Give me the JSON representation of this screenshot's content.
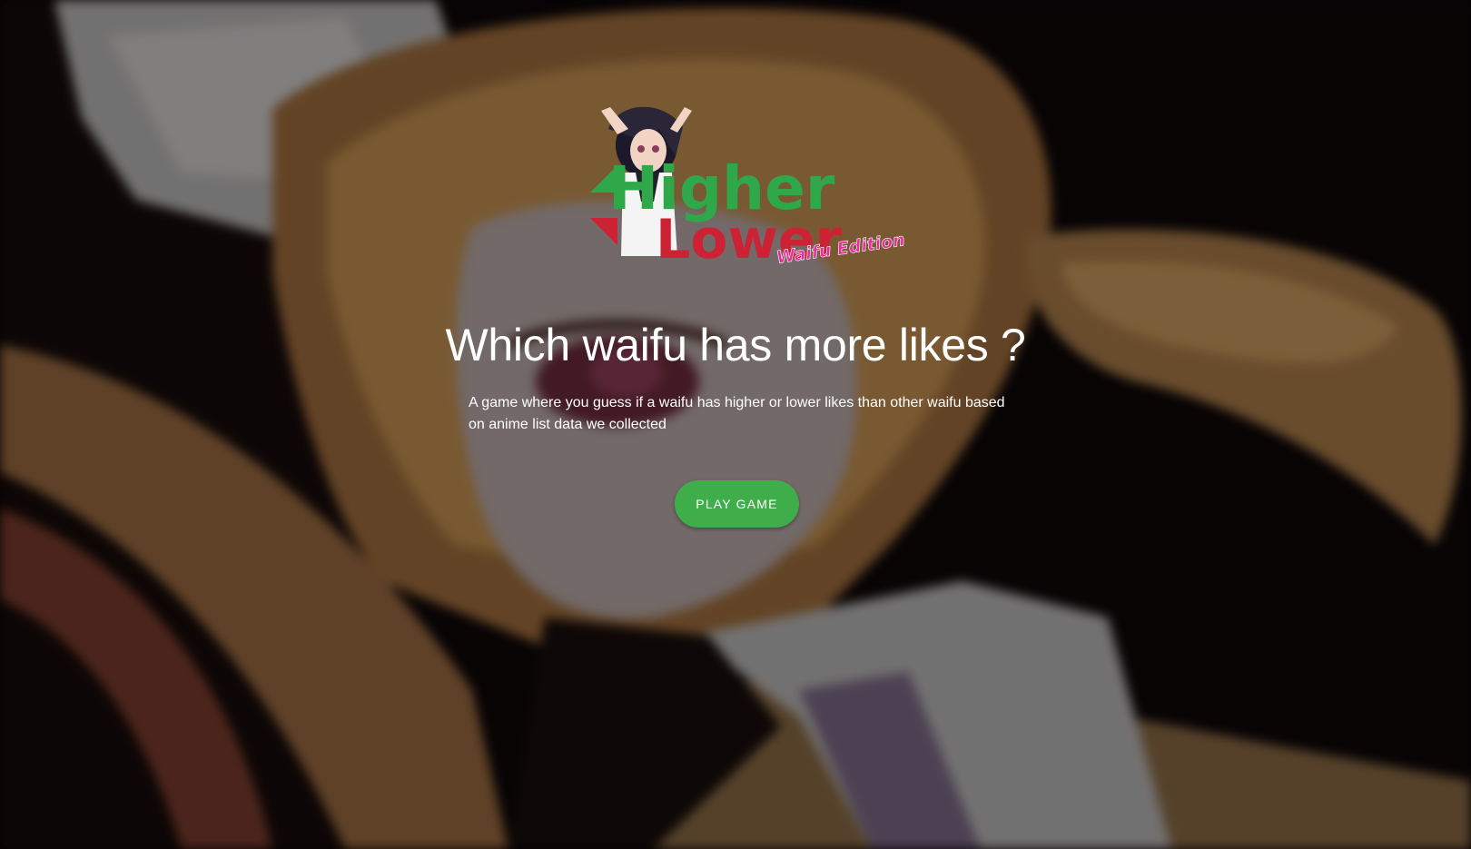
{
  "logo": {
    "line1": "Higher",
    "line2": "Lower",
    "tagline": "Waifu Edition",
    "colors": {
      "higher": "#2fa84a",
      "lower": "#cc2233",
      "tagline": "#e0309a"
    }
  },
  "hero": {
    "title": "Which waifu has more likes ?",
    "description": "A game where you guess if a waifu has higher or lower likes than other waifu based on anime list data we collected"
  },
  "actions": {
    "play_label": "PLAY GAME"
  },
  "theme": {
    "button_color": "#3fae4a",
    "text_color": "#ffffff"
  }
}
